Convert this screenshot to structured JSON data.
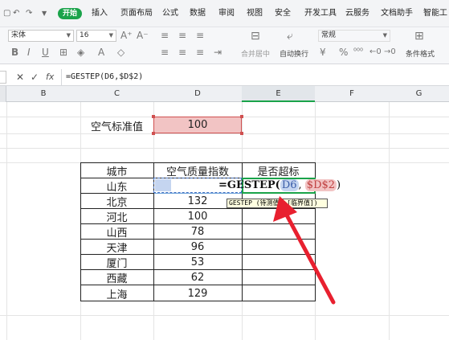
{
  "menu": {
    "start": "开始",
    "insert": "插入",
    "page_layout": "页面布局",
    "formulas": "公式",
    "data": "数据",
    "review": "审阅",
    "view": "视图",
    "security": "安全",
    "dev_tools": "开发工具",
    "cloud": "云服务",
    "doc_helper": "文档助手",
    "smart": "智能工"
  },
  "ribbon": {
    "font_name": "宋体",
    "font_size": "16",
    "merge_center": "合并居中",
    "wrap_text": "自动换行",
    "number_format": "常规",
    "conditional_format": "条件格式"
  },
  "formula_bar": {
    "content": "=GESTEP(D6,$D$2)"
  },
  "columns": [
    "B",
    "C",
    "D",
    "E",
    "F",
    "G"
  ],
  "sheet": {
    "standard_label": "空气标准值",
    "standard_value": "100",
    "headers": [
      "城市",
      "空气质量指数",
      "是否超标"
    ],
    "rows": [
      {
        "city": "山东",
        "value": ""
      },
      {
        "city": "北京",
        "value": "132"
      },
      {
        "city": "河北",
        "value": "100"
      },
      {
        "city": "山西",
        "value": "78"
      },
      {
        "city": "天津",
        "value": "96"
      },
      {
        "city": "厦门",
        "value": "53"
      },
      {
        "city": "西藏",
        "value": "62"
      },
      {
        "city": "上海",
        "value": "129"
      }
    ]
  },
  "editing": {
    "formula_head": "=GESTEP(",
    "ref1": "D6",
    "sep": ",",
    "ref2": "$D$2",
    "tail": ")",
    "tooltip": "GESTEP (待测值, [临界值])"
  },
  "colors": {
    "accent": "#1aa34a",
    "arrow": "#e8202f",
    "ref_blue": "#4472c4",
    "ref_red": "#d9534f"
  }
}
